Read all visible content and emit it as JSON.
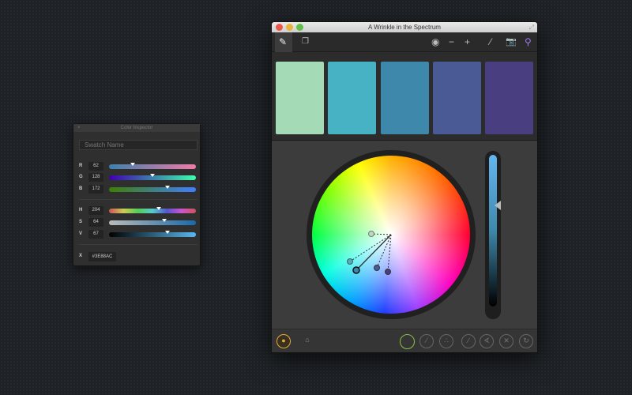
{
  "inspector": {
    "title": "Color Inspector",
    "close": "×",
    "swatch_placeholder": "Swatch Name",
    "rows": [
      {
        "label": "R",
        "value": "62",
        "pos": 0.27,
        "gradient": "linear-gradient(90deg,#3e80ac,#ee7da8)"
      },
      {
        "label": "G",
        "value": "128",
        "pos": 0.5,
        "gradient": "linear-gradient(90deg,#3e00ac,#3effac)"
      },
      {
        "label": "B",
        "value": "172",
        "pos": 0.67,
        "gradient": "linear-gradient(90deg,#3e8000,#3e80ff)"
      },
      {
        "label": "H",
        "value": "204",
        "pos": 0.57,
        "gradient": "linear-gradient(90deg,#c55,#cc5,#5c5,#5cc,#55c,#c5c,#c55)"
      },
      {
        "label": "S",
        "value": "64",
        "pos": 0.64,
        "gradient": "linear-gradient(90deg,#bbb,#1a6aa8)"
      },
      {
        "label": "V",
        "value": "67",
        "pos": 0.67,
        "gradient": "linear-gradient(90deg,#000,#5ab8f0)"
      }
    ],
    "hex_label": "X",
    "hex": "#3E88AC"
  },
  "window": {
    "title": "A Wrinkle in the Spectrum",
    "swatches": [
      "#a5dab6",
      "#46b2c3",
      "#3e88ac",
      "#4a5a94",
      "#493f80"
    ]
  }
}
